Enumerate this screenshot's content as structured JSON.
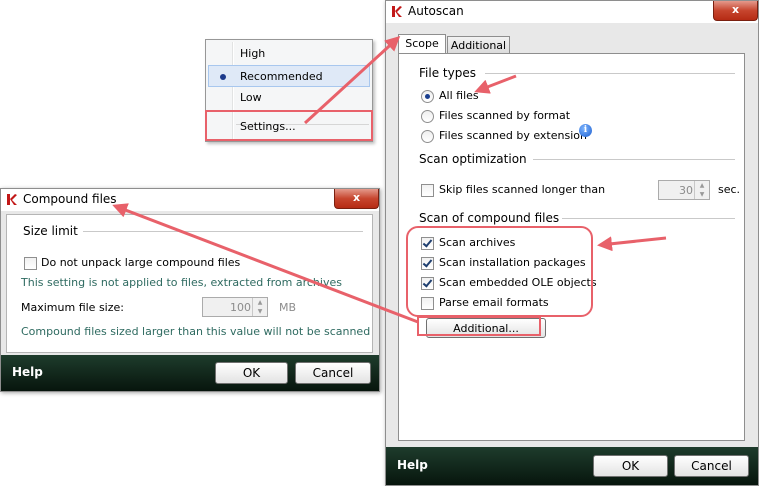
{
  "context_menu": {
    "items": [
      {
        "label": "High",
        "selected": false
      },
      {
        "label": "Recommended",
        "selected": true
      },
      {
        "label": "Low",
        "selected": false
      },
      {
        "label": "Settings...",
        "selected": false
      }
    ]
  },
  "autoscan": {
    "title": "Autoscan",
    "close_label": "x",
    "tabs": [
      {
        "label": "Scope",
        "active": true
      },
      {
        "label": "Additional",
        "active": false
      }
    ],
    "file_types": {
      "heading": "File types",
      "options": [
        "All files",
        "Files scanned by format",
        "Files scanned by extension"
      ],
      "selected_index": 0
    },
    "scan_optimization": {
      "heading": "Scan optimization",
      "skip_label": "Skip files scanned longer than",
      "skip_checked": false,
      "seconds_value": "30",
      "seconds_unit": "sec."
    },
    "compound": {
      "heading": "Scan of compound files",
      "items": [
        {
          "label": "Scan archives",
          "checked": true
        },
        {
          "label": "Scan installation packages",
          "checked": true
        },
        {
          "label": "Scan embedded OLE objects",
          "checked": true
        },
        {
          "label": "Parse email formats",
          "checked": false
        }
      ],
      "additional_button": "Additional..."
    },
    "footer": {
      "help": "Help",
      "ok": "OK",
      "cancel": "Cancel"
    }
  },
  "compound_files": {
    "title": "Compound files",
    "close_label": "x",
    "size_limit": {
      "heading": "Size limit",
      "unpack_label": "Do not unpack large compound files",
      "unpack_checked": false,
      "note1": "This setting is not applied to files, extracted from archives",
      "max_label": "Maximum file size:",
      "max_value": "100",
      "max_unit": "MB",
      "note2": "Compound files sized larger than this value will not be scanned"
    },
    "footer": {
      "help": "Help",
      "ok": "OK",
      "cancel": "Cancel"
    }
  },
  "colors": {
    "annotation": "#e8616a",
    "footer": "#0f2a1c",
    "note_text": "#2e6a60"
  }
}
